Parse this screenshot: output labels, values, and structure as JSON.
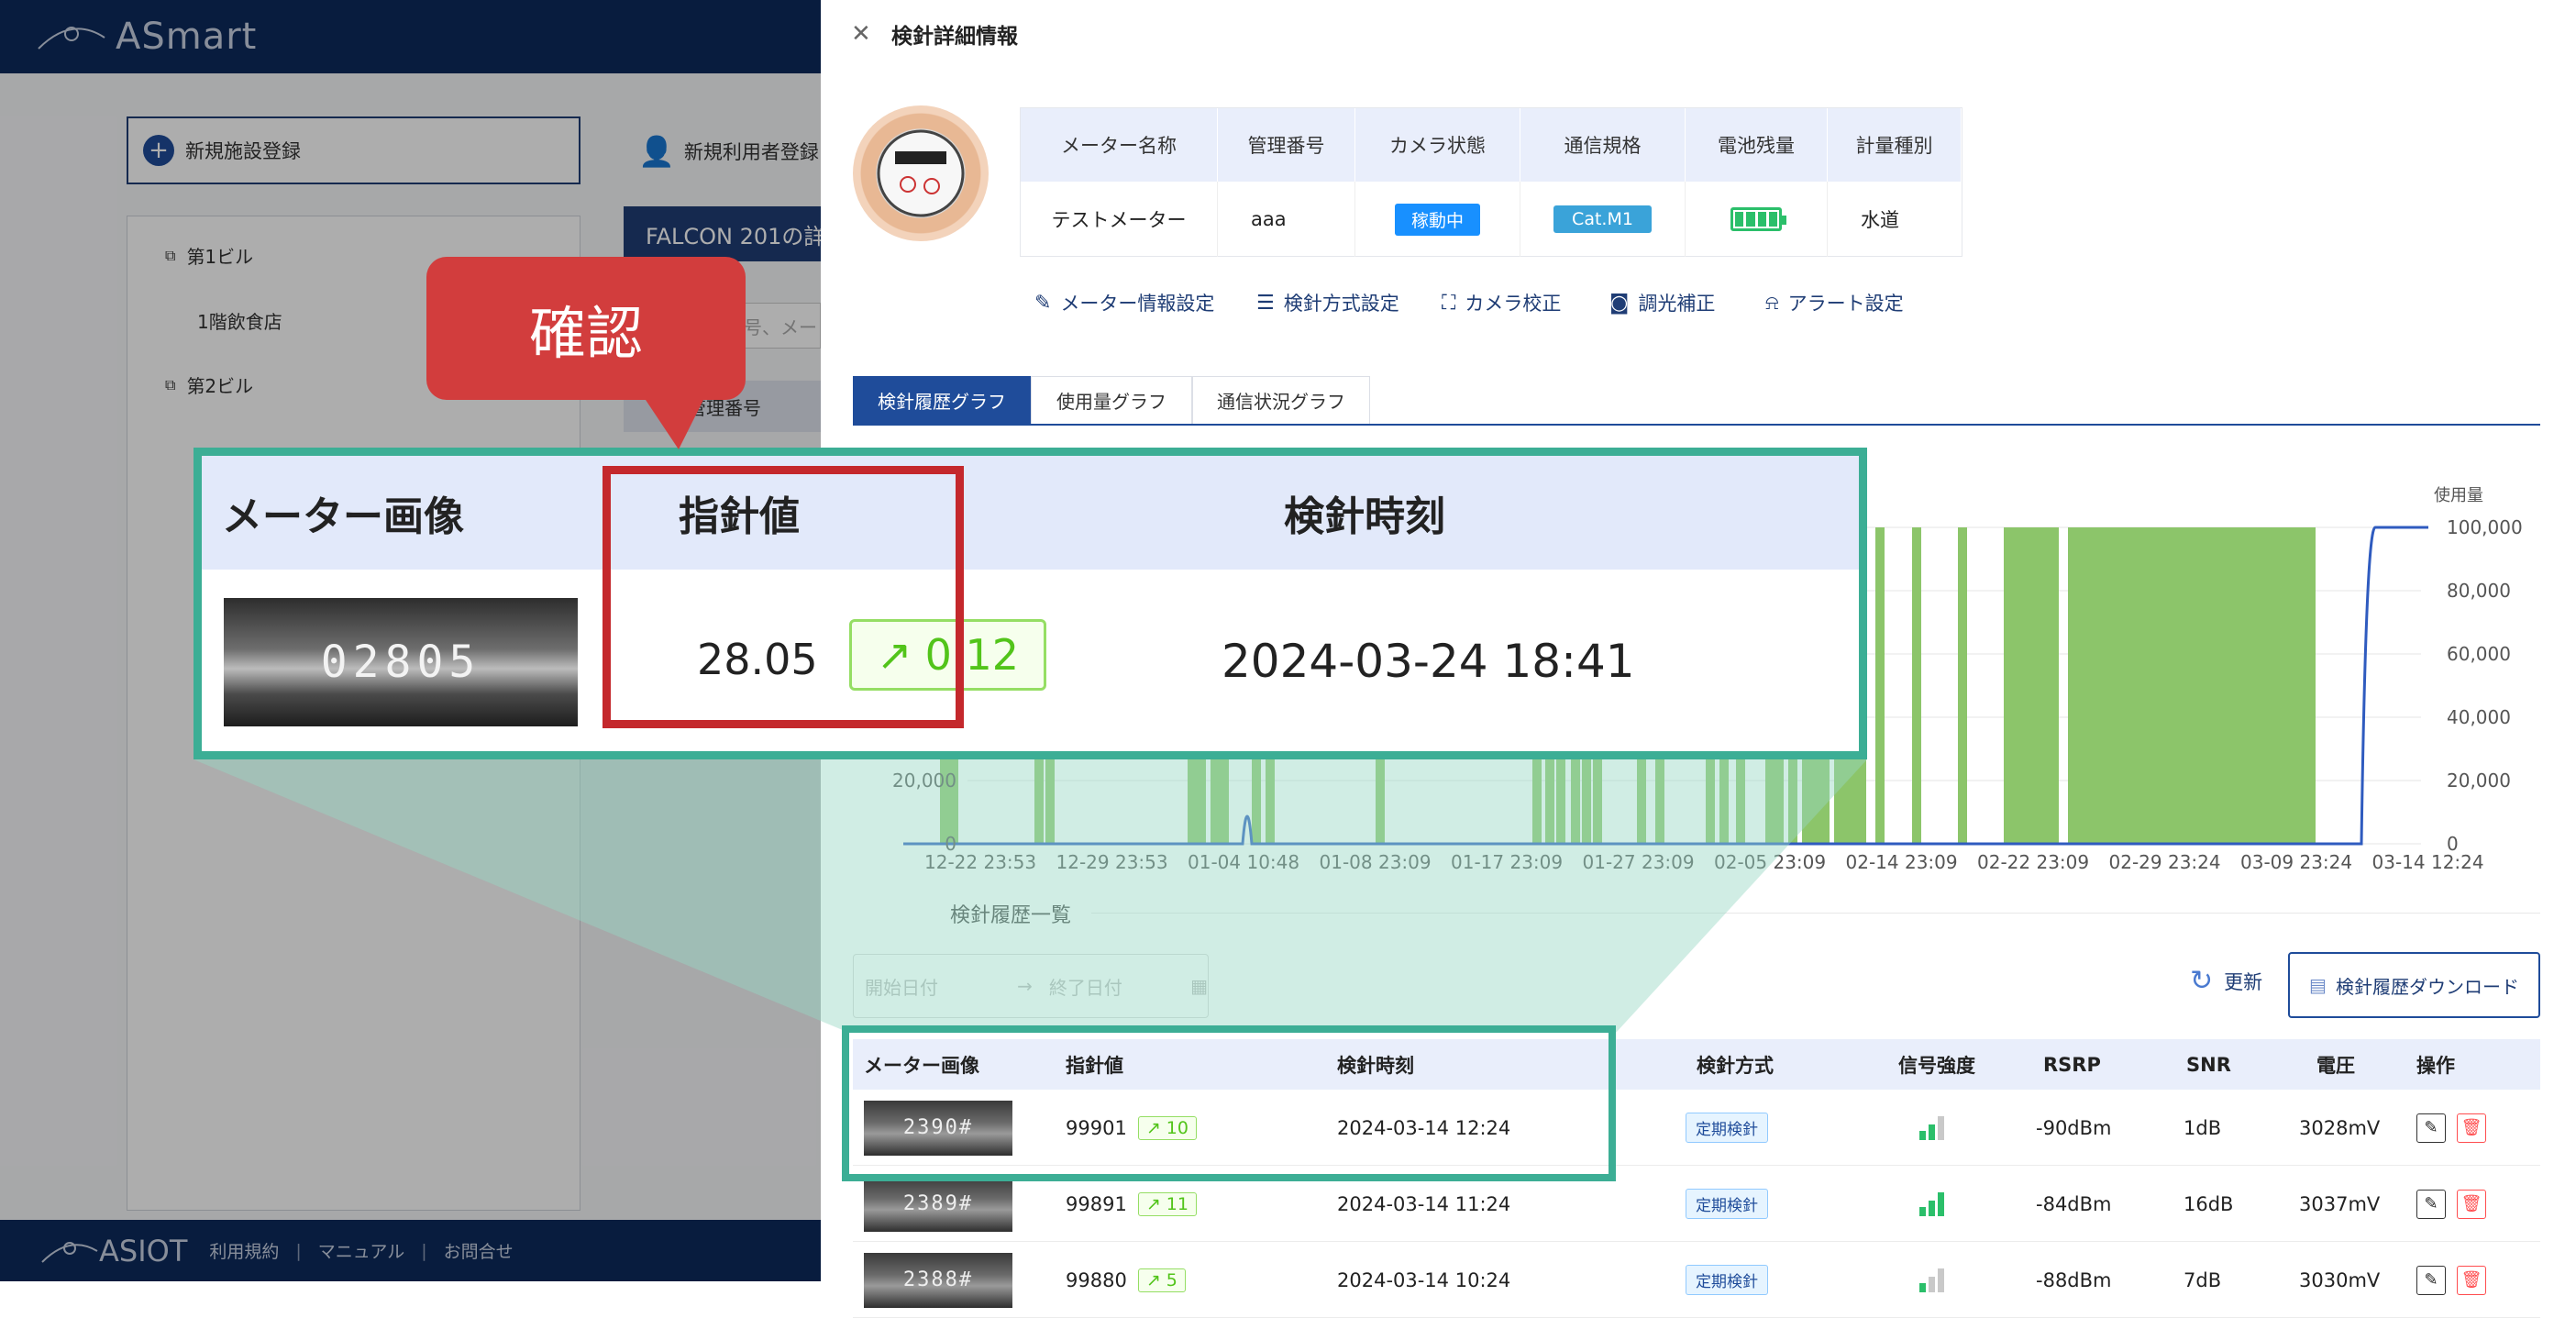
{
  "app": {
    "logo_text": "ASmart",
    "new_facility_label": "新規施設登録",
    "new_user_label": "新規利用者登録",
    "tree": [
      "第1ビル",
      "1階飲食店",
      "第2ビル"
    ],
    "falcon_title": "FALCON 201の詳",
    "search_placeholder": "号、メー",
    "bg_table_header": "管理番号",
    "footer": {
      "logo": "ASIOT",
      "links": [
        "利用規約",
        "マニュアル",
        "お問合せ"
      ]
    }
  },
  "drawer": {
    "title": "検針詳細情報",
    "info_headers": [
      "メーター名称",
      "管理番号",
      "カメラ状態",
      "通信規格",
      "電池残量",
      "計量種別"
    ],
    "info_values": {
      "name": "テストメーター",
      "id": "aaa",
      "camera": "稼動中",
      "protocol": "Cat.M1",
      "type": "水道"
    },
    "actions": [
      "メーター情報設定",
      "検針方式設定",
      "カメラ校正",
      "調光補正",
      "アラート設定"
    ],
    "tabs": [
      "検針履歴グラフ",
      "使用量グラフ",
      "通信状況グラフ"
    ],
    "history_label": "検針履歴一覧",
    "date_start": "開始日付",
    "date_end": "終了日付",
    "refresh_label": "更新",
    "download_label": "検針履歴ダウンロード",
    "table_headers": [
      "メーター画像",
      "指針値",
      "検針時刻",
      "検針方式",
      "信号強度",
      "RSRP",
      "SNR",
      "電圧",
      "操作"
    ],
    "rows": [
      {
        "thumb": "2390#",
        "value": "99901",
        "delta": "10",
        "time": "2024-03-14 12:24",
        "method": "定期検針",
        "signal": 2,
        "rsrp": "-90dBm",
        "snr": "1dB",
        "voltage": "3028mV"
      },
      {
        "thumb": "2389#",
        "value": "99891",
        "delta": "11",
        "time": "2024-03-14 11:24",
        "method": "定期検針",
        "signal": 3,
        "rsrp": "-84dBm",
        "snr": "16dB",
        "voltage": "3037mV"
      },
      {
        "thumb": "2388#",
        "value": "99880",
        "delta": "5",
        "time": "2024-03-14 10:24",
        "method": "定期検針",
        "signal": 1,
        "rsrp": "-88dBm",
        "snr": "7dB",
        "voltage": "3030mV"
      }
    ]
  },
  "chart_data": {
    "type": "bar",
    "ylabel": "使用量",
    "ylim": [
      0,
      100000
    ],
    "yticks": [
      "100,000",
      "80,000",
      "60,000",
      "40,000",
      "20,000",
      "0"
    ],
    "xticks": [
      "12-22 23:53",
      "12-29 23:53",
      "01-04 10:48",
      "01-08 23:09",
      "01-17 23:09",
      "01-27 23:09",
      "02-05 23:09",
      "02-14 23:09",
      "02-22 23:09",
      "02-29 23:24",
      "03-09 23:24",
      "03-14 12:24"
    ],
    "bar_color": "#8cc56a",
    "line_color": "#2f5bbf"
  },
  "callout": {
    "label": "確認",
    "zoom_headers": [
      "メーター画像",
      "指針値",
      "検針時刻"
    ],
    "zoom_thumb": "02805",
    "zoom_value": "28.05",
    "zoom_delta": "0.12",
    "zoom_time": "2024-03-24 18:41"
  }
}
